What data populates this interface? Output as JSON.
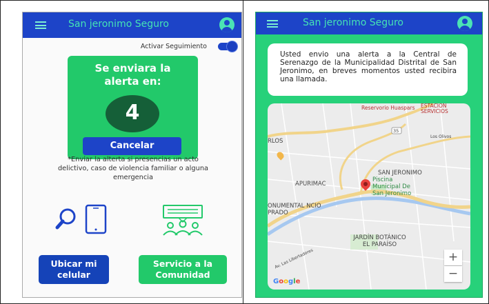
{
  "left_screen": {
    "app_title": "San jeronimo Seguro",
    "tracking_label": "Activar Seguimiento",
    "tracking_on": true,
    "countdown": {
      "message_line1": "Se enviara la",
      "message_line2": "alerta en:",
      "number": "4",
      "cancel_label": "Cancelar"
    },
    "hint_text": "*Enviar la alterta si presencias un acto delictivo, caso de violencia familiar o alguna emergencia",
    "buttons": {
      "locate_line1": "Ubicar mi",
      "locate_line2": "celular",
      "community_line1": "Servicio a la",
      "community_line2": "Comunidad"
    },
    "icons": [
      "menu-icon",
      "account-icon",
      "search-phone-icon",
      "community-chat-icon"
    ]
  },
  "right_screen": {
    "app_title": "San jeronimo Seguro",
    "alert_text": "Usted envio una alerta a la Central de Serenazgo de la Municipalidad Distrital de San Jeronimo, en breves momentos usted recibira una llamada.",
    "map": {
      "labels": {
        "reservorio": "Reservorio Huaspars",
        "estacion": "ESTACIÓN SERVICIOS",
        "route": "35",
        "los_olivos": "Los Olivos",
        "rlos": "RLOS",
        "san_jeronimo": "SAN JERONIMO",
        "apurimac": "APURIMAC",
        "piscina": "Piscina Municipal De San Jeronimo",
        "monumental": "ONUMENTAL NCIO PRADO",
        "jardin": "JARDÍN BOTÁNICO EL PARAÍSO",
        "av": "Av. Las Libertadores"
      },
      "zoom_in": "+",
      "zoom_out": "−",
      "attribution": "Google"
    }
  },
  "colors": {
    "appbar": "#1d44c8",
    "title_text": "#45e4b4",
    "green": "#22c96a",
    "dark_green": "#155f38",
    "blue_button": "#1543b8"
  }
}
